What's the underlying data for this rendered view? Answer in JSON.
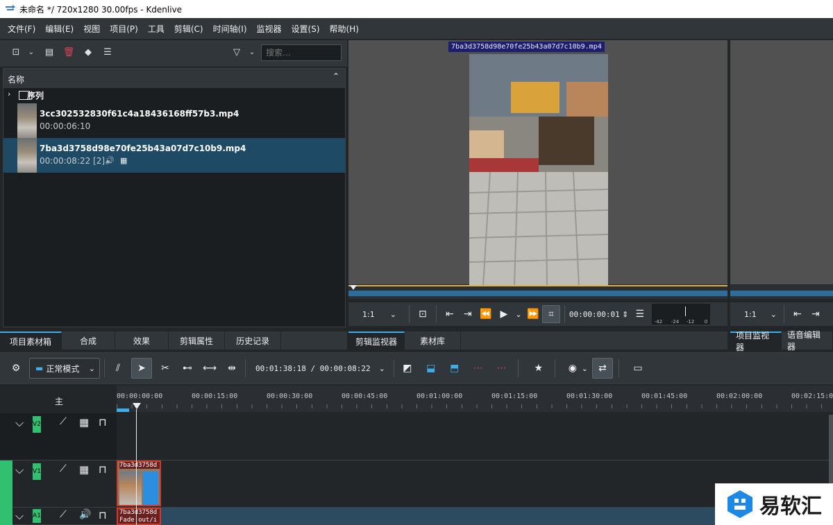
{
  "window": {
    "title": "未命名 */ 720x1280 30.00fps - Kdenlive"
  },
  "menu": [
    "文件(F)",
    "编辑(E)",
    "视图",
    "项目(P)",
    "工具",
    "剪辑(C)",
    "时间轴(I)",
    "监视器",
    "设置(S)",
    "帮助(H)"
  ],
  "bin": {
    "search_placeholder": "搜索…",
    "header": "名称",
    "folder": "序列",
    "clips": [
      {
        "name": "3cc302532830f61c4a18436168ff57b3.mp4",
        "meta": "00:00:06:10"
      },
      {
        "name": "7ba3d3758d98e70fe25b43a07d7c10b9.mp4",
        "meta": "00:00:08:22  [2]"
      }
    ]
  },
  "left_tabs": [
    "项目素材箱",
    "合成",
    "效果",
    "剪辑属性",
    "历史记录"
  ],
  "clip_monitor": {
    "clip_title": "7ba3d3758d98e70fe25b43a07d7c10b9.mp4",
    "zoom": "1:1",
    "timecode": "00:00:00:01",
    "audio_scale": [
      "-42",
      "-24",
      "-12",
      "0"
    ],
    "tabs": [
      "剪辑监视器",
      "素材库"
    ]
  },
  "project_monitor": {
    "zoom": "1:1",
    "tabs": [
      "项目监视器",
      "语音编辑器"
    ]
  },
  "timeline_toolbar": {
    "mode": "正常模式",
    "position": "00:01:38:18 / 00:00:08:22"
  },
  "timeline": {
    "master_label": "主",
    "ruler_labels": [
      "00:00:00:00",
      "00:00:15:00",
      "00:00:30:00",
      "00:00:45:00",
      "00:01:00:00",
      "00:01:15:00",
      "00:01:30:00",
      "00:01:45:00",
      "00:02:00:00",
      "00:02:15:00"
    ],
    "tracks": [
      {
        "label": "V2",
        "type": "video"
      },
      {
        "label": "V1",
        "type": "video"
      },
      {
        "label": "A1",
        "type": "audio"
      }
    ],
    "video_clip_label": "7ba3d3758d",
    "audio_clip_label": "7ba3d3758d",
    "audio_clip_sub": "Fade out/i"
  },
  "watermark": {
    "text": "易软汇"
  },
  "colors": {
    "accent": "#3daee9",
    "track_label": "#30c070",
    "clip_border": "#d23a2a",
    "selection": "#1e4a66"
  }
}
